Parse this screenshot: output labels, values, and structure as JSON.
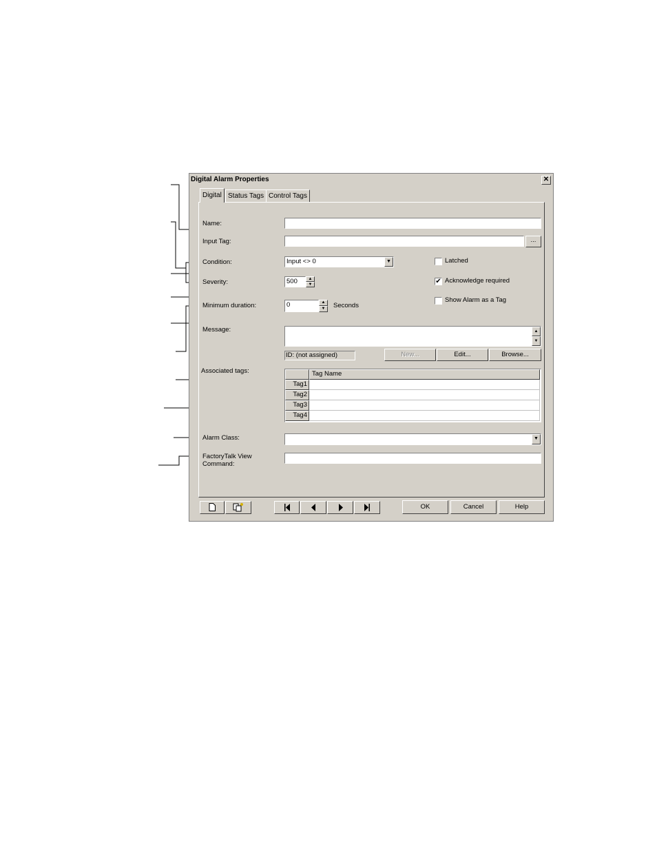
{
  "window": {
    "title": "Digital Alarm Properties",
    "close_glyph": "✕"
  },
  "tabs": [
    {
      "label": "Digital"
    },
    {
      "label": "Status Tags"
    },
    {
      "label": "Control Tags"
    }
  ],
  "form": {
    "name_label": "Name:",
    "name_value": "",
    "input_tag_label": "Input Tag:",
    "input_tag_value": "",
    "browse_glyph": "...",
    "condition_label": "Condition:",
    "condition_value": "Input <> 0",
    "severity_label": "Severity:",
    "severity_value": "500",
    "min_duration_label": "Minimum duration:",
    "min_duration_value": "0",
    "seconds_label": "Seconds",
    "message_label": "Message:",
    "message_value": "",
    "message_id": "ID: (not assigned)",
    "new_button": "New...",
    "edit_button": "Edit...",
    "browse_button": "Browse...",
    "associated_tags_label": "Associated tags:",
    "tag_name_header": "Tag Name",
    "tag_rows": [
      "Tag1",
      "Tag2",
      "Tag3",
      "Tag4"
    ],
    "alarm_class_label": "Alarm Class:",
    "alarm_class_value": "",
    "ftview_label_line1": "FactoryTalk View",
    "ftview_label_line2": "Command:",
    "ftview_value": ""
  },
  "options": {
    "latched_label": "Latched",
    "latched_checked": false,
    "ack_label": "Acknowledge required",
    "ack_checked": true,
    "show_tag_label": "Show Alarm as a Tag",
    "show_tag_checked": false
  },
  "footer": {
    "ok": "OK",
    "cancel": "Cancel",
    "help": "Help"
  },
  "icons": {
    "new": "new-document-icon",
    "paste": "paste-icon",
    "first": "first-record-icon",
    "prev": "previous-record-icon",
    "next": "next-record-icon",
    "last": "last-record-icon"
  },
  "colors": {
    "face": "#d4d0c8",
    "shadow": "#404040"
  }
}
